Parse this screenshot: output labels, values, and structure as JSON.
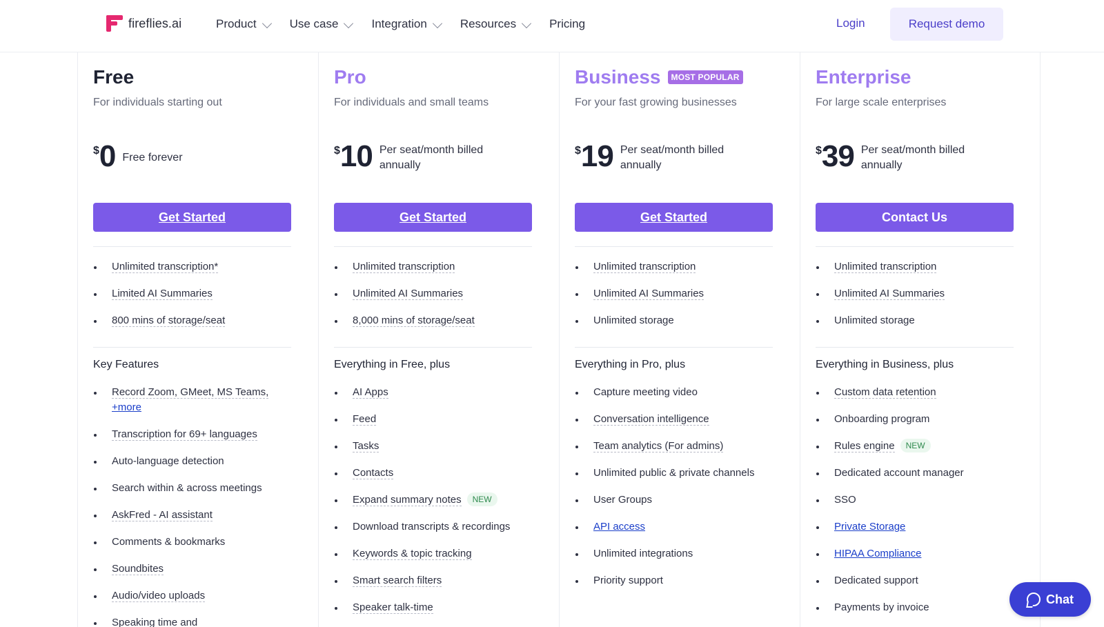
{
  "header": {
    "logo_text": "fireflies.ai",
    "nav": [
      "Product",
      "Use case",
      "Integration",
      "Resources",
      "Pricing"
    ],
    "login_label": "Login",
    "demo_label": "Request demo"
  },
  "plans": [
    {
      "name": "Free",
      "subtitle": "For individuals starting out",
      "currency": "$",
      "price": "0",
      "price_desc": "Free forever",
      "cta": "Get Started",
      "basics": [
        "Unlimited transcription*",
        "Limited AI Summaries",
        "800 mins of storage/seat"
      ],
      "section": "Key Features",
      "features": [
        "Record Zoom, GMeet, MS Teams,",
        "+more",
        "Transcription for 69+ languages",
        "Auto-language detection",
        "Search within & across meetings",
        "AskFred - AI assistant",
        "Comments & bookmarks",
        "Soundbites",
        "Audio/video uploads",
        "Speaking time and"
      ]
    },
    {
      "name": "Pro",
      "subtitle": "For individuals and small teams",
      "currency": "$",
      "price": "10",
      "price_desc": "Per seat/month billed annually",
      "cta": "Get Started",
      "basics": [
        "Unlimited transcription",
        "Unlimited AI Summaries",
        "8,000 mins of storage/seat"
      ],
      "section": "Everything in Free, plus",
      "features": [
        "AI Apps",
        "Feed",
        "Tasks",
        "Contacts",
        "Expand summary notes",
        "Download transcripts & recordings",
        "Keywords & topic tracking",
        "Smart search filters",
        "Speaker talk-time"
      ],
      "new_tag": "NEW"
    },
    {
      "name": "Business",
      "badge": "MOST POPULAR",
      "subtitle": "For your fast growing businesses",
      "currency": "$",
      "price": "19",
      "price_desc": "Per seat/month billed annually",
      "cta": "Get Started",
      "basics": [
        "Unlimited transcription",
        "Unlimited AI Summaries",
        "Unlimited storage"
      ],
      "section": "Everything in Pro, plus",
      "features": [
        "Capture meeting video",
        "Conversation intelligence",
        "Team analytics (For admins)",
        "Unlimited public & private channels",
        "User Groups",
        "API access",
        "Unlimited integrations",
        "Priority support"
      ]
    },
    {
      "name": "Enterprise",
      "subtitle": "For large scale enterprises",
      "currency": "$",
      "price": "39",
      "price_desc": "Per seat/month billed annually",
      "cta": "Contact Us",
      "basics": [
        "Unlimited transcription",
        "Unlimited AI Summaries",
        "Unlimited storage"
      ],
      "section": "Everything in Business, plus",
      "features": [
        "Custom data retention",
        "Onboarding program",
        "Rules engine",
        "Dedicated account manager",
        "SSO",
        "Private Storage",
        "HIPAA Compliance",
        "Dedicated support",
        "Payments by invoice"
      ],
      "new_tag": "NEW"
    }
  ],
  "chat_label": "Chat",
  "colors": {
    "accent": "#7b5ae8",
    "brand": "#e5286f",
    "title_purple": "#9f7cf0",
    "chat": "#3a3fd4"
  }
}
